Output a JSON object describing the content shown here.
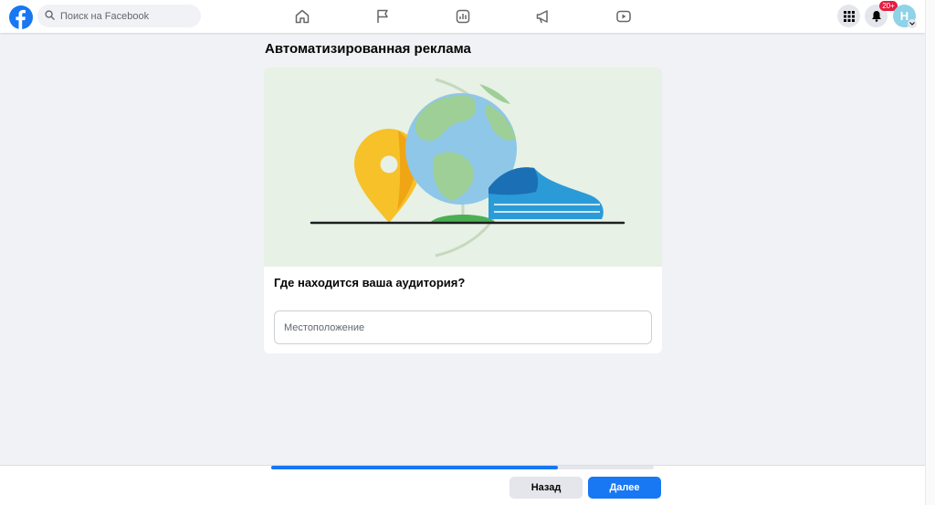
{
  "header": {
    "search_placeholder": "Поиск на Facebook",
    "notifications_badge": "20+",
    "avatar_letter": "H",
    "nav_icons": [
      "home-icon",
      "flag-icon",
      "analytics-icon",
      "megaphone-icon",
      "video-icon"
    ]
  },
  "main": {
    "title": "Автоматизированная реклама",
    "question": "Где находится ваша аудитория?",
    "location_placeholder": "Местоположение",
    "location_value": ""
  },
  "footer": {
    "progress_fraction": 0.75,
    "back_label": "Назад",
    "next_label": "Далее"
  },
  "colors": {
    "brand": "#1877f2",
    "background": "#f0f2f5",
    "badge": "#e41e3f",
    "illustration_bg": "#e7f1e5"
  }
}
